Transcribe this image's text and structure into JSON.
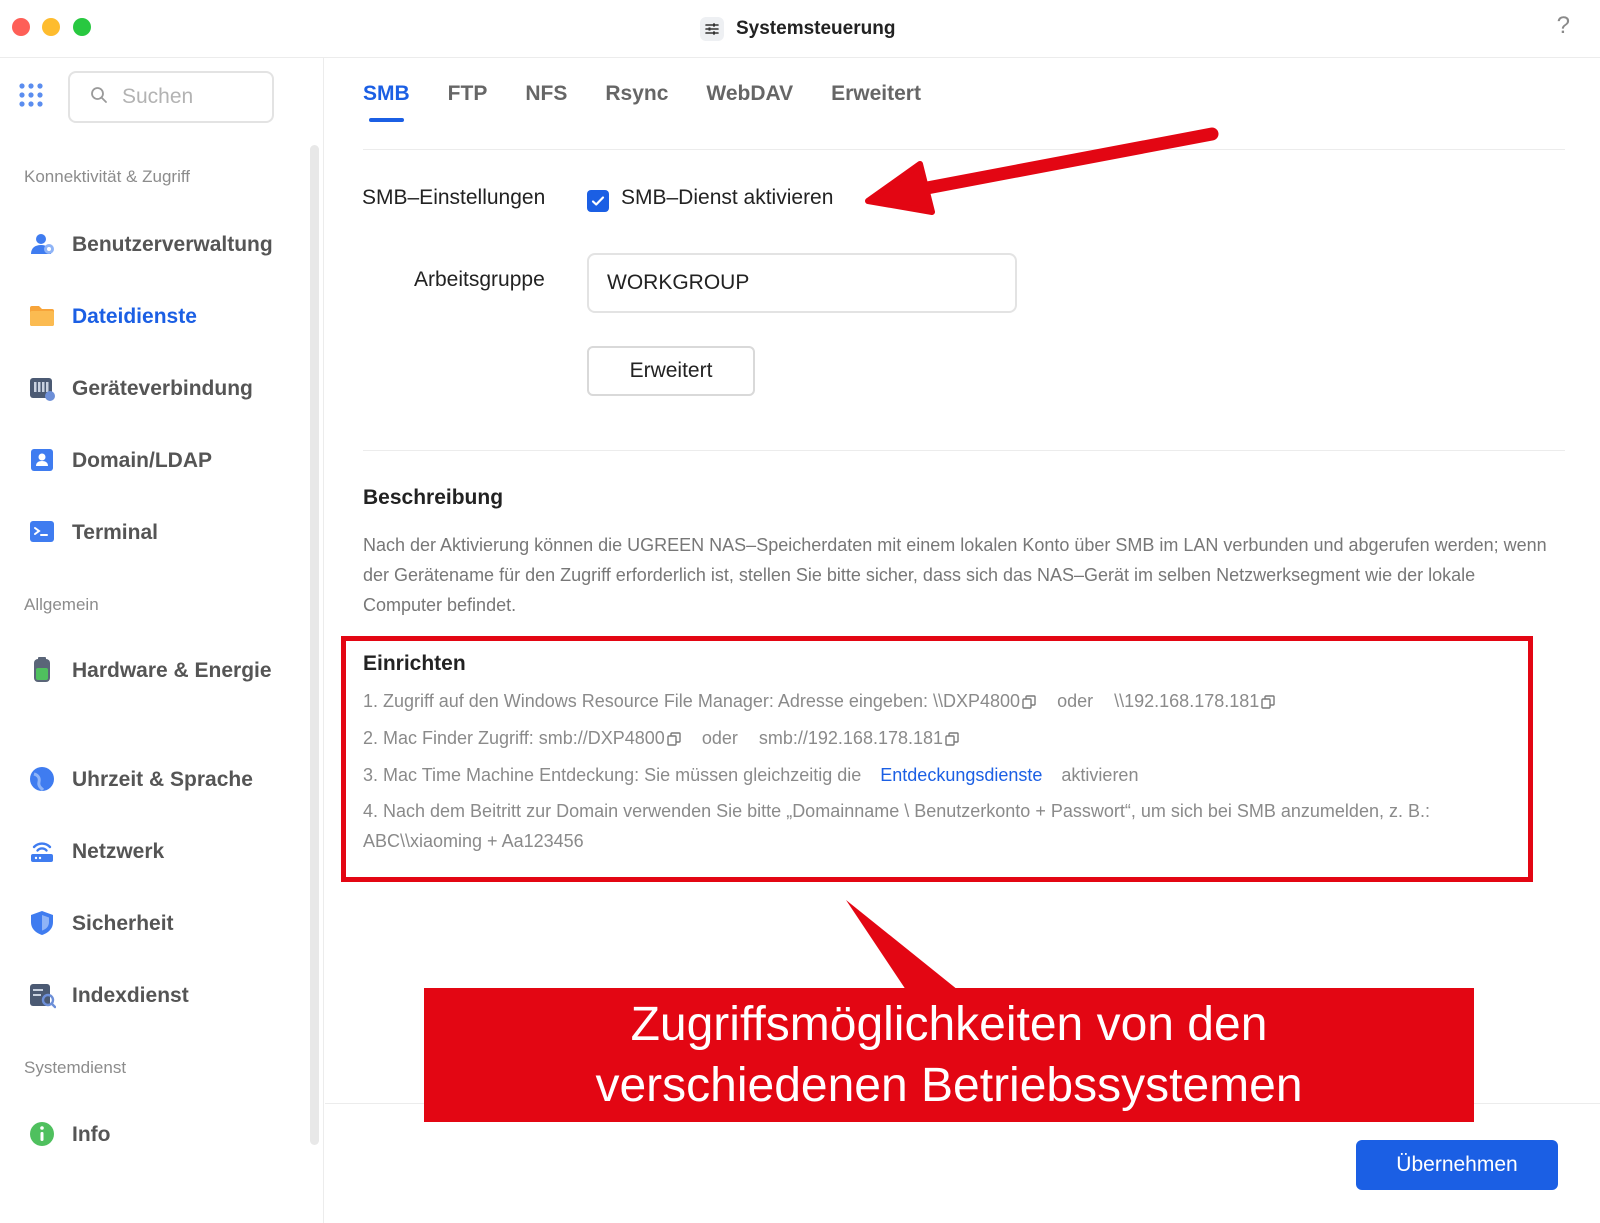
{
  "window": {
    "title": "Systemsteuerung",
    "help": "?"
  },
  "sidebar": {
    "search_placeholder": "Suchen",
    "sections": [
      {
        "label": "Konnektivität & Zugriff"
      },
      {
        "label": "Allgemein"
      },
      {
        "label": "Systemdienst"
      }
    ],
    "items": [
      {
        "label": "Benutzerverwaltung",
        "icon": "users-icon"
      },
      {
        "label": "Dateidienste",
        "icon": "folder-icon",
        "active": true
      },
      {
        "label": "Geräteverbindung",
        "icon": "device-icon"
      },
      {
        "label": "Domain/LDAP",
        "icon": "domain-icon"
      },
      {
        "label": "Terminal",
        "icon": "terminal-icon"
      },
      {
        "label": "Hardware & Energie",
        "icon": "battery-icon"
      },
      {
        "label": "Uhrzeit & Sprache",
        "icon": "globe-icon"
      },
      {
        "label": "Netzwerk",
        "icon": "router-icon"
      },
      {
        "label": "Sicherheit",
        "icon": "shield-icon"
      },
      {
        "label": "Indexdienst",
        "icon": "index-icon"
      },
      {
        "label": "Info",
        "icon": "info-icon"
      }
    ]
  },
  "tabs": [
    {
      "label": "SMB",
      "active": true
    },
    {
      "label": "FTP"
    },
    {
      "label": "NFS"
    },
    {
      "label": "Rsync"
    },
    {
      "label": "WebDAV"
    },
    {
      "label": "Erweitert"
    }
  ],
  "smb": {
    "settings_label": "SMB–Einstellungen",
    "enable_label": "SMB–Dienst aktivieren",
    "enabled": true,
    "workgroup_label": "Arbeitsgruppe",
    "workgroup_value": "WORKGROUP",
    "advanced_button": "Erweitert"
  },
  "description": {
    "heading": "Beschreibung",
    "text": "Nach der Aktivierung können die UGREEN NAS–Speicherdaten mit einem lokalen Konto über SMB im LAN verbunden und abgerufen werden; wenn der Gerätename für den Zugriff erforderlich ist, stellen Sie bitte sicher, dass sich das NAS–Gerät im selben Netzwerksegment wie der lokale Computer befindet."
  },
  "setup": {
    "heading": "Einrichten",
    "step1_text": "1. Zugriff auf den Windows Resource File Manager: Adresse eingeben:",
    "step1_path_a": "\\\\DXP4800",
    "step1_or": "oder",
    "step1_path_b": "\\\\192.168.178.181",
    "step2_text": "2. Mac Finder Zugriff:",
    "step2_path_a": "smb://DXP4800",
    "step2_or": "oder",
    "step2_path_b": "smb://192.168.178.181",
    "step3_text": "3. Mac Time Machine Entdeckung: Sie müssen gleichzeitig die",
    "step3_link": "Entdeckungsdienste",
    "step3_suffix": "aktivieren",
    "step4_text": "4. Nach dem Beitritt zur Domain verwenden Sie bitte „Domainname \\ Benutzerkonto + Passwort“, um sich bei SMB anzumelden, z. B.: ABC\\\\xiaoming + Aa123456"
  },
  "footer": {
    "apply_button": "Übernehmen"
  },
  "annotation": {
    "line1": "Zugriffsmöglichkeiten von den",
    "line2": "verschiedenen Betriebssystemen",
    "color": "#e30613"
  },
  "colors": {
    "accent": "#1b5fe4",
    "annotation": "#e30613"
  }
}
